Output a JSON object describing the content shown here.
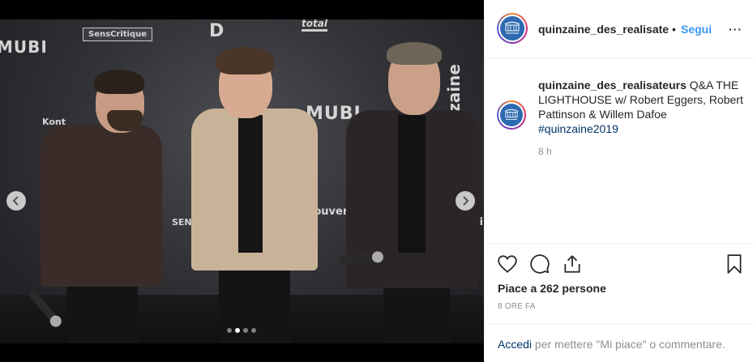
{
  "post": {
    "account": {
      "username_header": "quinzaine_des_realisateu",
      "username": "quinzaine_des_realisateurs",
      "avatar_icon": "quinzaine-logo-icon",
      "avatar_color": "#2d6ab0"
    },
    "header": {
      "separator": "•",
      "follow_label": "Segui",
      "more_label": "···"
    },
    "caption": {
      "text": "Q&A THE LIGHTHOUSE w/ Robert Eggers, Robert Pattinson & Willem Dafoe",
      "hashtag": "#quinzaine2019",
      "time": "8 h"
    },
    "actions": {
      "like_icon": "heart-icon",
      "comment_icon": "comment-bubble-icon",
      "share_icon": "share-icon",
      "save_icon": "bookmark-icon",
      "likes_text": "Piace a 262 persone",
      "date_text": "8 ORE FA"
    },
    "login": {
      "link_label": "Accedi",
      "rest_text": " per mettere \"Mi piace\" o commentare."
    },
    "media": {
      "carousel_count": 4,
      "active_index": 1,
      "prev_icon": "chevron-left-icon",
      "next_icon": "chevron-right-icon",
      "sponsor_logos": [
        "MUBI",
        "SensCritique",
        "D",
        "total",
        "MUBI",
        "Kont",
        "Souver",
        "kinbi",
        "SEN OBS",
        "quinzaine"
      ]
    },
    "colors": {
      "link_blue": "#3897f0",
      "hashtag_blue": "#003569",
      "secondary_text": "#8e8e8e",
      "border": "#efefef"
    }
  }
}
